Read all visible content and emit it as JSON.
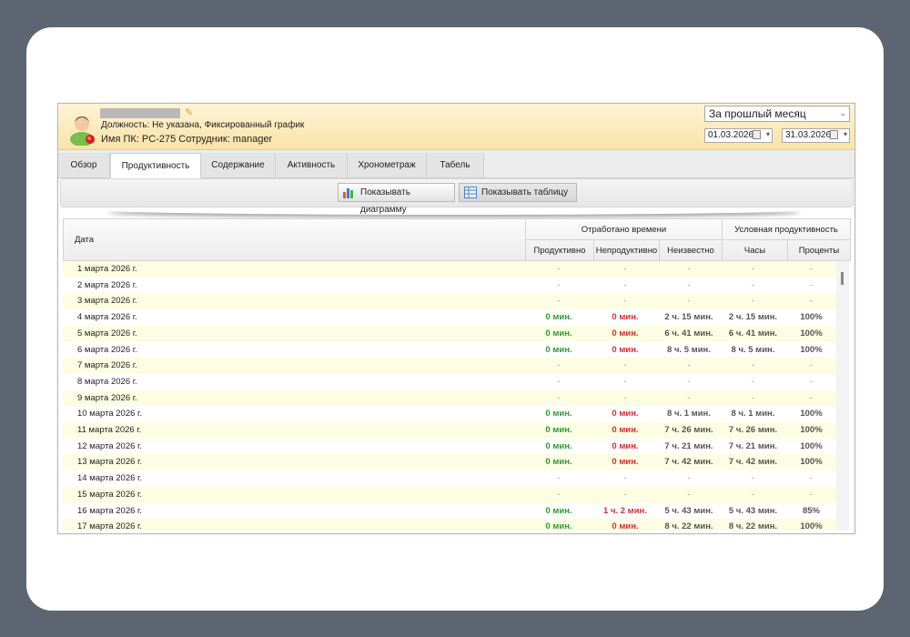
{
  "header": {
    "position_line": "Должность: Не указана, Фиксированный график",
    "pc_line": "Имя ПК: PC-275 Сотрудник: manager",
    "period": "За прошлый месяц",
    "date_from": "01.03.2026",
    "date_to": "31.03.2026"
  },
  "tabs": [
    {
      "label": "Обзор"
    },
    {
      "label": "Продуктивность"
    },
    {
      "label": "Содержание"
    },
    {
      "label": "Активность"
    },
    {
      "label": "Хронометраж"
    },
    {
      "label": "Табель"
    }
  ],
  "toolbar": {
    "show_chart": "Показывать диаграмму",
    "show_table": "Показывать таблицу"
  },
  "table": {
    "col_date": "Дата",
    "group_worked": "Отработано времени",
    "group_cond": "Условная продуктивность",
    "col_prod": "Продуктивно",
    "col_unprod": "Непродуктивно",
    "col_unknown": "Неизвестно",
    "col_hours": "Часы",
    "col_percent": "Проценты",
    "rows": [
      {
        "date": "1 марта 2026 г.",
        "prod": "-",
        "unprod": "-",
        "unknown": "-",
        "hours": "-",
        "pct": "-"
      },
      {
        "date": "2 марта 2026 г.",
        "prod": "-",
        "unprod": "-",
        "unknown": "-",
        "hours": "-",
        "pct": "-"
      },
      {
        "date": "3 марта 2026 г.",
        "prod": "-",
        "unprod": "-",
        "unknown": "-",
        "hours": "-",
        "pct": "-"
      },
      {
        "date": "4 марта 2026 г.",
        "prod": "0 мин.",
        "unprod": "0 мин.",
        "unknown": "2 ч. 15 мин.",
        "hours": "2 ч. 15 мин.",
        "pct": "100%"
      },
      {
        "date": "5 марта 2026 г.",
        "prod": "0 мин.",
        "unprod": "0 мин.",
        "unknown": "6 ч. 41 мин.",
        "hours": "6 ч. 41 мин.",
        "pct": "100%"
      },
      {
        "date": "6 марта 2026 г.",
        "prod": "0 мин.",
        "unprod": "0 мин.",
        "unknown": "8 ч. 5 мин.",
        "hours": "8 ч. 5 мин.",
        "pct": "100%"
      },
      {
        "date": "7 марта 2026 г.",
        "prod": "-",
        "unprod": "-",
        "unknown": "-",
        "hours": "-",
        "pct": "-"
      },
      {
        "date": "8 марта 2026 г.",
        "prod": "-",
        "unprod": "-",
        "unknown": "-",
        "hours": "-",
        "pct": "-"
      },
      {
        "date": "9 марта 2026 г.",
        "prod": "-",
        "unprod": "-",
        "unknown": "-",
        "hours": "-",
        "pct": "-"
      },
      {
        "date": "10 марта 2026 г.",
        "prod": "0 мин.",
        "unprod": "0 мин.",
        "unknown": "8 ч. 1 мин.",
        "hours": "8 ч. 1 мин.",
        "pct": "100%"
      },
      {
        "date": "11 марта 2026 г.",
        "prod": "0 мин.",
        "unprod": "0 мин.",
        "unknown": "7 ч. 26 мин.",
        "hours": "7 ч. 26 мин.",
        "pct": "100%"
      },
      {
        "date": "12 марта 2026 г.",
        "prod": "0 мин.",
        "unprod": "0 мин.",
        "unknown": "7 ч. 21 мин.",
        "hours": "7 ч. 21 мин.",
        "pct": "100%"
      },
      {
        "date": "13 марта 2026 г.",
        "prod": "0 мин.",
        "unprod": "0 мин.",
        "unknown": "7 ч. 42 мин.",
        "hours": "7 ч. 42 мин.",
        "pct": "100%"
      },
      {
        "date": "14 марта 2026 г.",
        "prod": "-",
        "unprod": "-",
        "unknown": "-",
        "hours": "-",
        "pct": "-"
      },
      {
        "date": "15 марта 2026 г.",
        "prod": "-",
        "unprod": "-",
        "unknown": "-",
        "hours": "-",
        "pct": "-"
      },
      {
        "date": "16 марта 2026 г.",
        "prod": "0 мин.",
        "unprod": "1 ч. 2 мин.",
        "unknown": "5 ч. 43 мин.",
        "hours": "5 ч. 43 мин.",
        "pct": "85%"
      },
      {
        "date": "17 марта 2026 г.",
        "prod": "0 мин.",
        "unprod": "0 мин.",
        "unknown": "8 ч. 22 мин.",
        "hours": "8 ч. 22 мин.",
        "pct": "100%"
      }
    ]
  },
  "colors": {
    "productive": "#2e9a2e",
    "unproductive": "#d62e2e",
    "odd_row": "#fdfde4"
  }
}
